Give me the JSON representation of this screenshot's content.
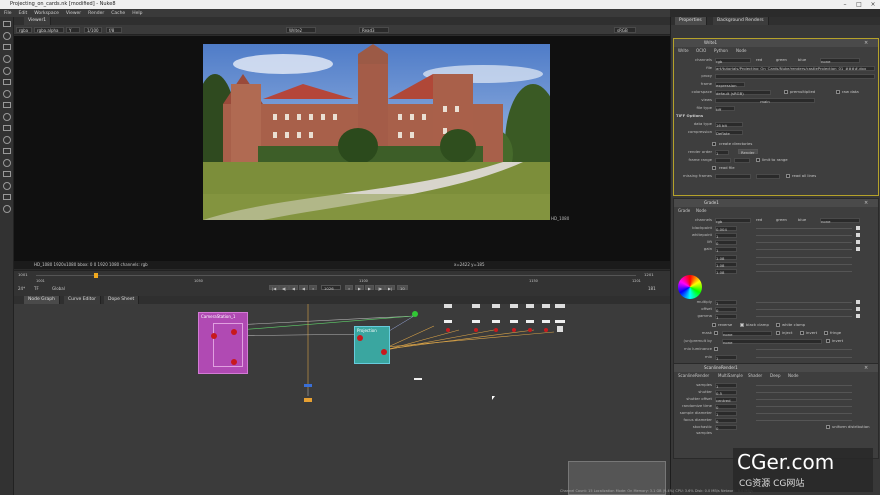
{
  "window": {
    "title": "Projecting_on_cards.nk [modified] - Nuke8"
  },
  "menu": [
    "File",
    "Edit",
    "Workspace",
    "Viewer",
    "Render",
    "Cache",
    "Help"
  ],
  "viewer": {
    "tab": "Viewer1",
    "channels": "rgba",
    "layer": "rgba.alpha",
    "colorspace": "Y",
    "proxy": "1/100",
    "fstop": "f/8",
    "zoom": "sRGB",
    "input_a": "Write2",
    "input_b": "Read3",
    "format_label": "HD_1080",
    "status": "HD_1080 1920x1080  bbox: 0 0 1920 1080 channels: rgb",
    "coords": "x=2422 y=185"
  },
  "timeline": {
    "start": "1001",
    "end": "1201",
    "ticks": [
      "1001",
      "1050",
      "1100",
      "1150",
      "1201"
    ],
    "fps_label": "24*",
    "fps_mode": "TF",
    "global": "Global",
    "current_frame": "1026",
    "frame_step": "10",
    "last": "181"
  },
  "node_tabs": [
    "Node Graph",
    "Curve Editor",
    "Dope Sheet"
  ],
  "nodes": {
    "camera_group": "CameraStation_1",
    "projection": "Projection"
  },
  "props": {
    "tabs": [
      "Properties",
      "Background Renders"
    ],
    "write": {
      "name": "Write1",
      "tabs": [
        "Write",
        "OCIO",
        "Python",
        "Node"
      ],
      "channels": "rgb",
      "chan_checks": [
        "red",
        "green",
        "blue",
        "none"
      ],
      "file": "art/tutorials/Projecting_On_Cards/Nuke/renders/castleProjection_01_####.dpx",
      "proxy_label": "proxy",
      "frame_label": "frame",
      "frame_value": "expression",
      "colorspace_label": "colorspace",
      "colorspace_value": "default (sRGB)",
      "premultiplied": "premultiplied",
      "raw_data": "raw data",
      "views_label": "views",
      "views_value": "main",
      "filetype_label": "file type",
      "filetype_value": "tiff",
      "tiff_options": "TIFF Options",
      "datatype_label": "data type",
      "datatype_value": "16 bit",
      "compression_label": "compression",
      "compression_value": "Deflate",
      "create_dirs": "create directories",
      "render_order_label": "render order",
      "render_order_value": "1",
      "render_button": "Render",
      "frame_range_label": "frame range",
      "limit_to_range": "limit to range",
      "read_file": "read file",
      "missing_frames_label": "missing frames",
      "read_all_lines": "read all lines"
    },
    "grade": {
      "name": "Grade1",
      "tabs": [
        "Grade",
        "Node"
      ],
      "channels": "rgb",
      "chan_checks": [
        "red",
        "green",
        "blue",
        "none"
      ],
      "rows": [
        {
          "label": "blackpoint",
          "value": "0.004"
        },
        {
          "label": "whitepoint",
          "value": "1"
        },
        {
          "label": "lift",
          "value": "0"
        },
        {
          "label": "gain",
          "value": "1"
        },
        {
          "label": "",
          "value": "1.08"
        },
        {
          "label": "",
          "value": "1.08"
        },
        {
          "label": "",
          "value": "1.08"
        },
        {
          "label": "multiply",
          "value": "1"
        },
        {
          "label": "offset",
          "value": "0"
        },
        {
          "label": "gamma",
          "value": "1"
        }
      ],
      "reverse": "reverse",
      "black_clamp": "black clamp",
      "white_clamp": "white clamp",
      "mask_label": "mask",
      "mask_value": "none",
      "inject": "inject",
      "invert": "invert",
      "fringe": "fringe",
      "unpremult_label": "(un)premult by",
      "unpremult_value": "none",
      "mix_lum_label": "mix luminance",
      "mix_label": "mix",
      "mix_value": "1"
    },
    "scanline": {
      "name": "ScanlineRender1",
      "tabs": [
        "ScanlineRender",
        "MultiSample",
        "Shader",
        "Deep",
        "Node"
      ],
      "rows": [
        {
          "label": "samples",
          "value": "1"
        },
        {
          "label": "shutter",
          "value": "0.5"
        },
        {
          "label": "shutter offset",
          "value": "centred"
        },
        {
          "label": "randomize time",
          "value": "0"
        },
        {
          "label": "sample diameter",
          "value": "1"
        },
        {
          "label": "focus diameter",
          "value": "0"
        },
        {
          "label": "stochastic samples",
          "value": "0"
        }
      ],
      "uniform_distribution": "uniform distribution"
    }
  },
  "statusbar": "Channel Count: 15  Localization Mode: On  Memory: 3.1 GB (9.4%)  CPU: 3.6%  Disk: 0.0 MB/s  Network: 0.0 MB/s",
  "watermark": {
    "main": "CGer.com",
    "sub": "CG资源 CG网站"
  },
  "colors": {
    "accent": "#f0a81e",
    "group_purple": "#b04ab3",
    "projection_teal": "#3aa6a0",
    "write_border": "#b5a22a"
  }
}
